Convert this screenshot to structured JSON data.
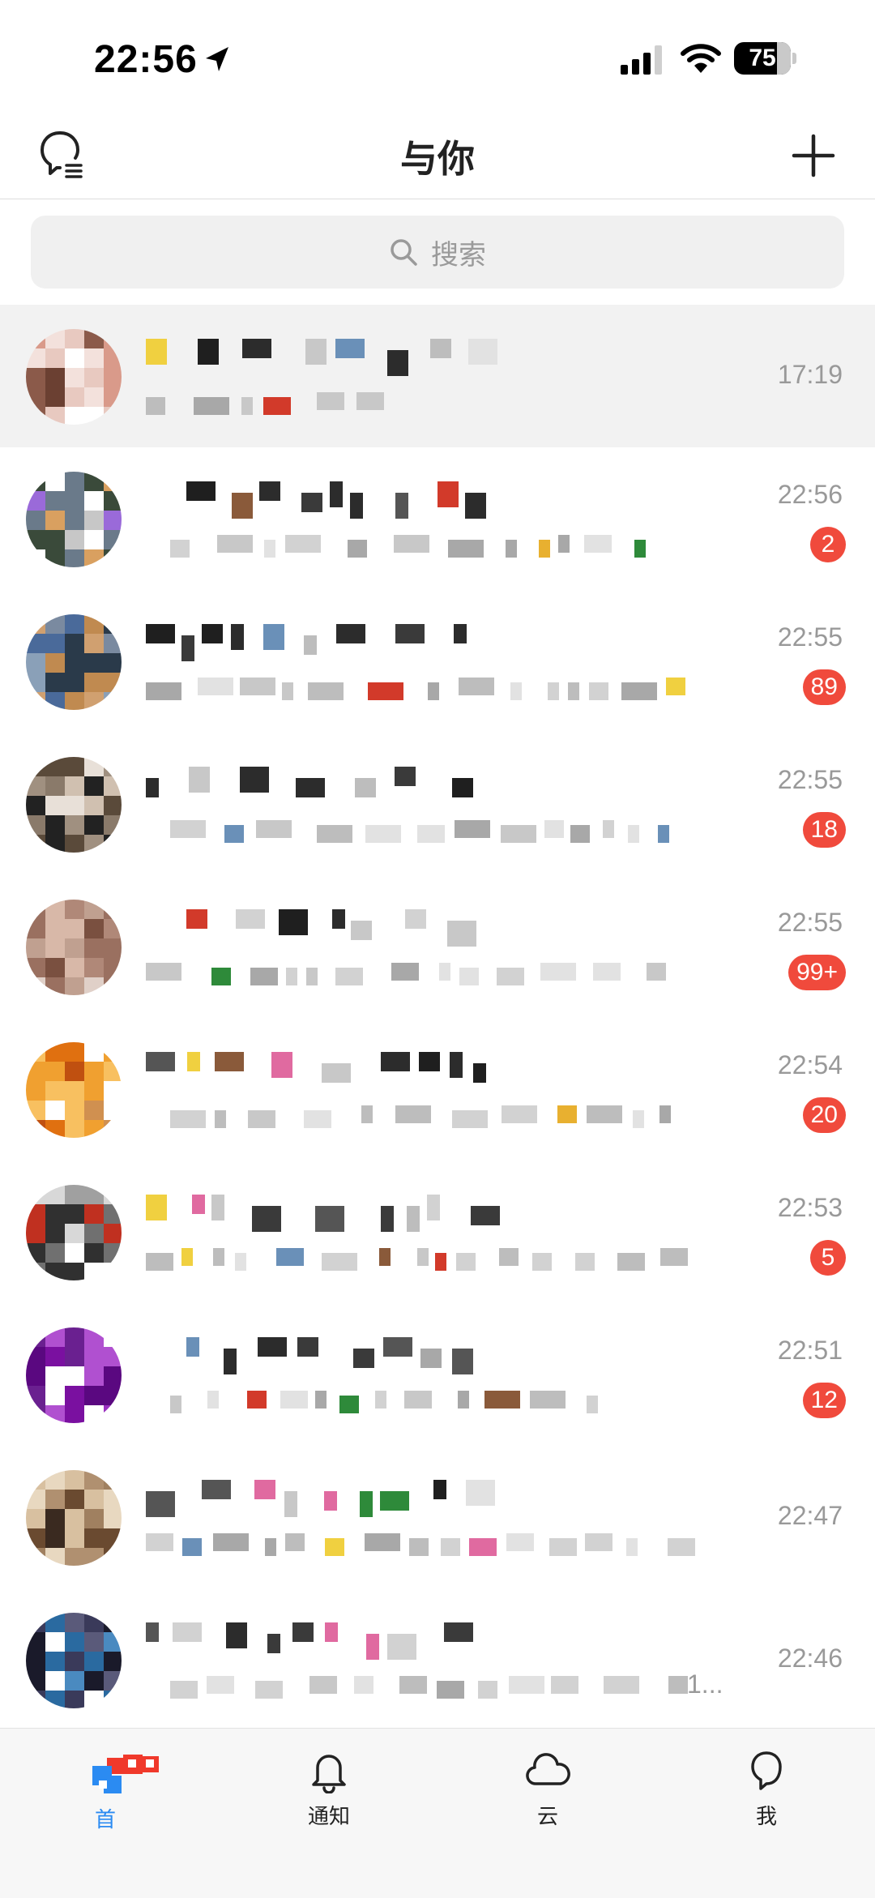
{
  "status_bar": {
    "time": "22:56",
    "battery": "75",
    "battery_level": 0.75
  },
  "nav": {
    "title": "与你",
    "left_icon": "contacts-icon",
    "right_icon": "plus-icon"
  },
  "search": {
    "placeholder": "搜索"
  },
  "chats": [
    {
      "time": "17:19",
      "badge": "",
      "pinned": true
    },
    {
      "time": "22:56",
      "badge": "2"
    },
    {
      "time": "22:55",
      "badge": "89"
    },
    {
      "time": "22:55",
      "badge": "18"
    },
    {
      "time": "22:55",
      "badge": "99+"
    },
    {
      "time": "22:54",
      "badge": "20"
    },
    {
      "time": "22:53",
      "badge": "5"
    },
    {
      "time": "22:51",
      "badge": "12"
    },
    {
      "time": "22:47",
      "badge": ""
    },
    {
      "time": "22:46",
      "badge": "",
      "preview_tail": "1..."
    }
  ],
  "tabs": [
    {
      "label": "首",
      "icon": "home-icon",
      "active": true
    },
    {
      "label": "通知",
      "icon": "bell-icon"
    },
    {
      "label": "云",
      "icon": "cloud-icon"
    },
    {
      "label": "我",
      "icon": "user-icon"
    }
  ],
  "colors": {
    "accent": "#2b8bf2",
    "badge": "#f04a3c",
    "pinned_bg": "#f2f2f2"
  }
}
